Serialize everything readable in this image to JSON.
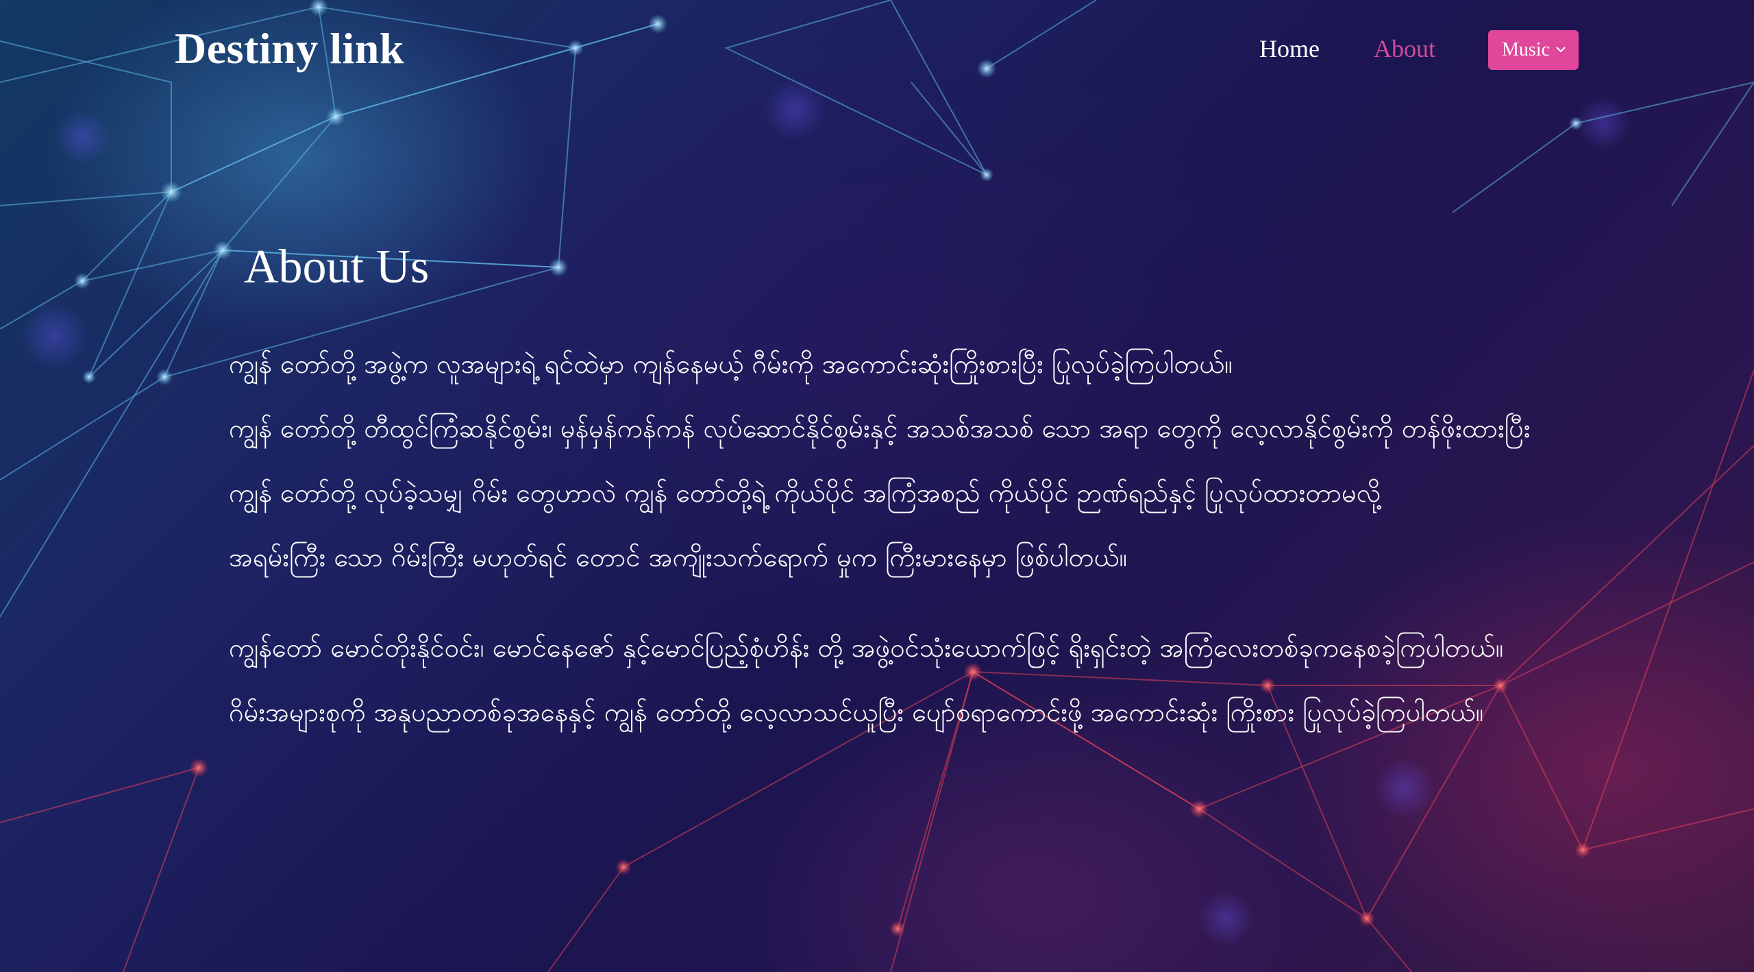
{
  "header": {
    "brand": "Destiny link",
    "nav": {
      "home": "Home",
      "about": "About",
      "music": "Music"
    }
  },
  "main": {
    "title": "About Us",
    "paragraphs": [
      {
        "lines": [
          "ကျွန် တော်တို့ အဖွဲ့က လူအများရဲ့ ရင်ထဲမှာ ကျန်နေမယ့် ဂီမ်းကို အကောင်းဆုံးကြိုးစားပြီး ပြုလုပ်ခဲ့ကြပါတယ်။",
          "ကျွန် တော်တို့ တီထွင်ကြံဆနိုင်စွမ်း၊ မှန်မှန်ကန်ကန် လုပ်ဆောင်နိုင်စွမ်းနှင့် အသစ်အသစ် သော အရာ တွေကို လေ့လာနိုင်စွမ်းကို တန်ဖိုးထားပြီး",
          "ကျွန် တော်တို့ လုပ်ခဲ့သမျှ ဂိမ်း တွေဟာလဲ ကျွန် တော်တို့ရဲ့ ကိုယ်ပိုင် အကြံအစည် ကိုယ်ပိုင် ဉာဏ်ရည်နှင့် ပြုလုပ်ထားတာမလို့",
          "အရမ်းကြီး သော ဂိမ်းကြီး မဟုတ်ရင် တောင် အကျိုးသက်ရောက် မှုက ကြီးမားနေမှာ ဖြစ်ပါတယ်။"
        ]
      },
      {
        "lines": [
          "ကျွန်တော် မောင်တိုးနိုင်ဝင်း၊ မောင်နေဇော် နှင့်မောင်ပြည့်စုံဟိန်း တို့ အဖွဲ့ဝင်သုံးယောက်ဖြင့် ရိုးရှင်းတဲ့ အကြံလေးတစ်ခုကနေစခဲ့ကြပါတယ်။",
          "ဂိမ်းအများစုကို အနုပညာတစ်ခုအနေနှင့် ကျွန် တော်တို့ လေ့လာသင်ယူပြီး ပျော်စရာကောင်းဖို့ အကောင်းဆုံး ကြိုးစား ပြုလုပ်ခဲ့ကြပါတယ်။"
        ]
      }
    ]
  }
}
